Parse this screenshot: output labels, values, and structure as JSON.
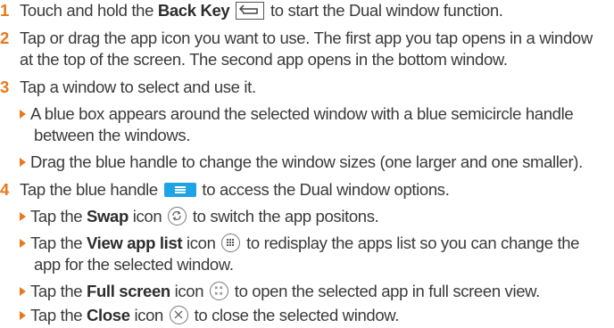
{
  "steps": [
    {
      "num": "1",
      "pre": "Touch and hold the ",
      "bold": "Back Key",
      "post": " to start the Dual window function."
    },
    {
      "num": "2",
      "line1": "Tap or drag the app icon you want to use. The first app you tap opens in a window",
      "line2": "at the top of the screen. The second app opens in the bottom window."
    },
    {
      "num": "3",
      "text": "Tap a window to select and use it."
    },
    {
      "num": "4",
      "pre": "Tap the blue handle ",
      "post": " to access the Dual window options."
    }
  ],
  "bullets3": [
    {
      "line1": "A blue box appears around the selected window with a blue semicircle handle",
      "line2": "between the windows."
    },
    {
      "line1": "Drag the blue handle to change the window sizes (one larger and one smaller)."
    }
  ],
  "bullets4": [
    {
      "pre": "Tap the ",
      "bold": "Swap",
      "mid": " icon ",
      "post": " to switch the app positons."
    },
    {
      "pre": "Tap the ",
      "bold": "View app list",
      "mid": " icon ",
      "post": " to redisplay the apps list so you can change the",
      "line2": "app for the selected window."
    },
    {
      "pre": "Tap the ",
      "bold": "Full screen",
      "mid": " icon ",
      "post": " to open the selected app in full screen view."
    },
    {
      "pre": "Tap the ",
      "bold": "Close",
      "mid": " icon ",
      "post": " to close the selected window."
    }
  ],
  "icons": {
    "back_key": "back-arrow-icon",
    "handle": "blue-handle-icon",
    "swap": "swap-icon",
    "view_app_list": "app-list-icon",
    "full_screen": "full-screen-icon",
    "close": "close-icon"
  },
  "colors": {
    "step_number": "#e8781c",
    "bullet": "#e8781c",
    "handle": "#1ea3e6"
  }
}
